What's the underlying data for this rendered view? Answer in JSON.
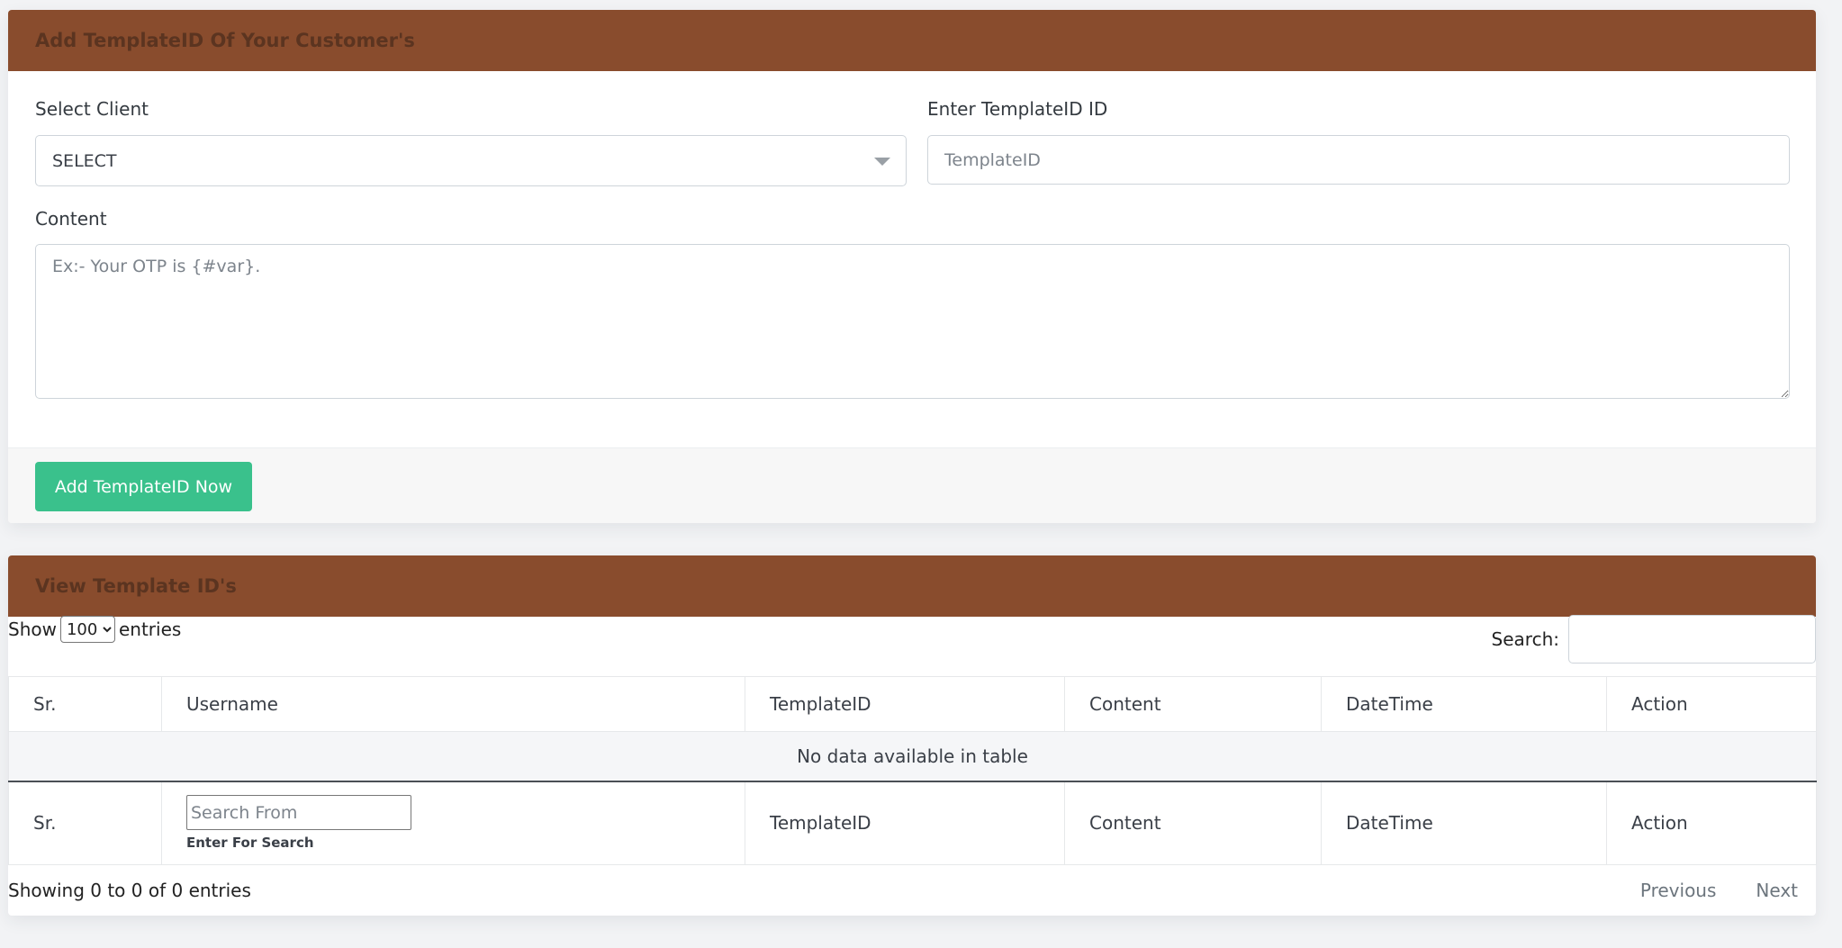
{
  "add_form": {
    "title": "Add TemplateID Of Your Customer's",
    "client_label": "Select Client",
    "client_value": "SELECT",
    "template_label": "Enter TemplateID ID",
    "template_placeholder": "TemplateID",
    "content_label": "Content",
    "content_placeholder": "Ex:- Your OTP is {#var}.",
    "submit_label": "Add TemplateID Now"
  },
  "list": {
    "title": "View Template ID's",
    "show_label": "Show",
    "length_value": "100",
    "entries_label": "entries",
    "search_label": "Search:",
    "columns": [
      "Sr.",
      "Username",
      "TemplateID",
      "Content",
      "DateTime",
      "Action"
    ],
    "empty_message": "No data available in table",
    "footer_search_placeholder": "Search From",
    "footer_search_hint": "Enter For Search",
    "info": "Showing 0 to 0 of 0 entries",
    "prev_label": "Previous",
    "next_label": "Next"
  },
  "colors": {
    "header_bg": "#894c2d",
    "header_text": "#5b3420",
    "button_bg": "#3ac18c"
  }
}
